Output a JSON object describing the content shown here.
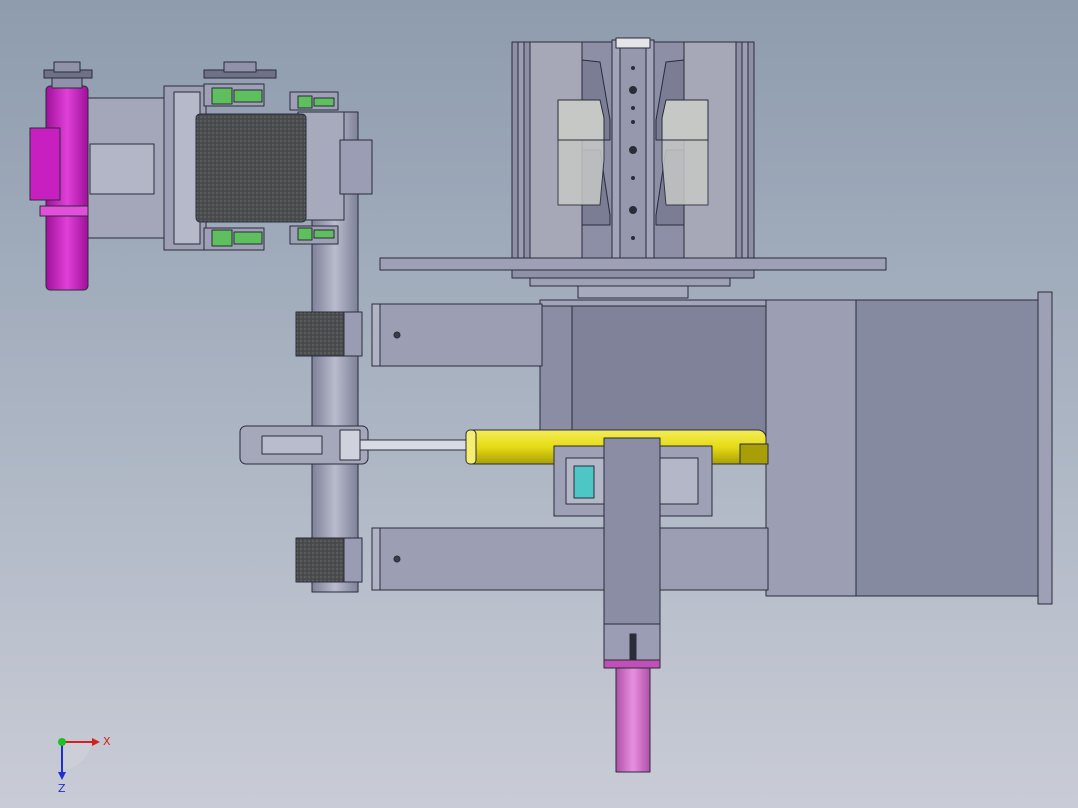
{
  "view": {
    "background_top": "#8e9cae",
    "background_bottom": "#c9ccd6"
  },
  "triad": {
    "x_label": "X",
    "z_label": "Z",
    "x_color": "#d62020",
    "y_color": "#20c020",
    "z_color": "#2030d0"
  },
  "colors": {
    "steel": "#9a9cb4",
    "steel_light": "#b8bacb",
    "steel_dark": "#7c7f97",
    "dark_box": "#868aa0",
    "knurl": "#4a4c4e",
    "magenta": "#c820c0",
    "pink_rod": "#d870d0",
    "yellow": "#e6dc14",
    "green": "#5fbf5f",
    "cyan": "#4fc6c6",
    "outline": "#2a2c3a"
  },
  "parts": [
    "base-plate",
    "upper-coil-assembly",
    "vertical-center-post",
    "gearbox-housing",
    "end-flange",
    "upper-arm-bar",
    "lower-arm-bar",
    "vertical-shaft",
    "upper-knurled-collar",
    "lower-knurled-collar",
    "hydraulic-cylinder",
    "piston-rod",
    "clevis-link",
    "bearing-housing",
    "vertical-slider",
    "pink-piston-rod",
    "left-roller-frame",
    "knurled-drum",
    "magenta-motor",
    "top-sprocket-left",
    "top-sprocket-right"
  ]
}
